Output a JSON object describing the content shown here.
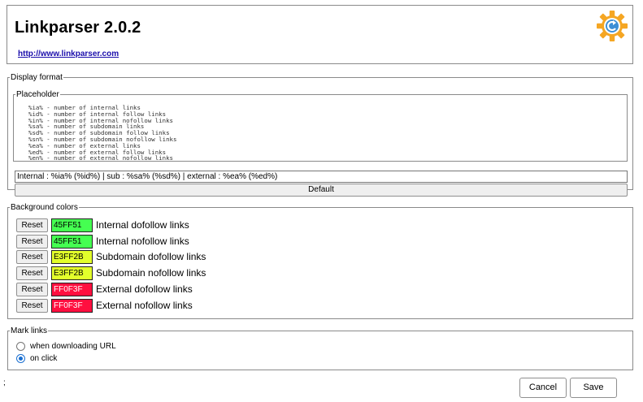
{
  "header": {
    "title": "Linkparser 2.0.2",
    "url": "http://www.linkparser.com",
    "logo_icon": "gear-refresh-logo"
  },
  "display_format": {
    "legend": "Display format",
    "placeholder": {
      "legend": "Placeholder",
      "lines": [
        "%ia% - number of internal links",
        "%id% - number of internal follow links",
        "%in% - number of internal nofollow links",
        "%sa% - number of subdomain links",
        "%sd% - number of subdomain follow links",
        "%sn% - number of subdomain nofollow links",
        "%ea% - number of external links",
        "%ed% - number of external follow links",
        "%en% - number of external nofollow links"
      ]
    },
    "format_value": "Internal : %ia% (%id%) | sub : %sa% (%sd%) | external : %ea% (%ed%)",
    "default_label": "Default"
  },
  "background_colors": {
    "legend": "Background colors",
    "reset_label": "Reset",
    "rows": [
      {
        "code": "45FF51",
        "color": "#45FF51",
        "text_color": "#000000",
        "label": "Internal dofollow links"
      },
      {
        "code": "45FF51",
        "color": "#45FF51",
        "text_color": "#000000",
        "label": "Internal nofollow links"
      },
      {
        "code": "E3FF2B",
        "color": "#E3FF2B",
        "text_color": "#000000",
        "label": "Subdomain dofollow links"
      },
      {
        "code": "E3FF2B",
        "color": "#E3FF2B",
        "text_color": "#000000",
        "label": "Subdomain nofollow links"
      },
      {
        "code": "FF0F3F",
        "color": "#FF0F3F",
        "text_color": "#ffffff",
        "label": "External dofollow links"
      },
      {
        "code": "FF0F3F",
        "color": "#FF0F3F",
        "text_color": "#ffffff",
        "label": "External nofollow links"
      }
    ]
  },
  "mark_links": {
    "legend": "Mark links",
    "options": [
      {
        "label": "when downloading URL",
        "checked": false
      },
      {
        "label": "on click",
        "checked": true
      }
    ]
  },
  "footer": {
    "stray_text": ";",
    "cancel_label": "Cancel",
    "save_label": "Save"
  }
}
